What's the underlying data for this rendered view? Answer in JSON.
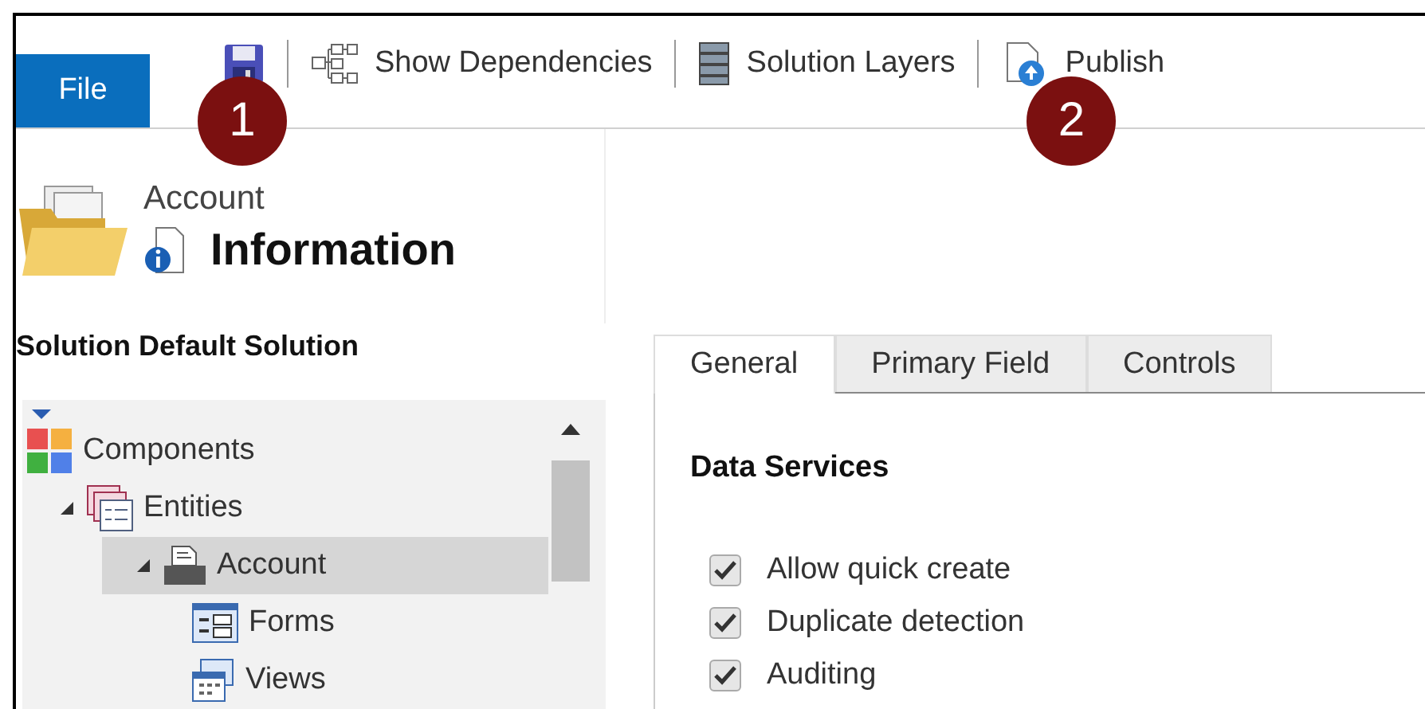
{
  "toolbar": {
    "file_button": "File",
    "items": [
      {
        "kind": "save",
        "callout": "1"
      },
      {
        "kind": "dependencies",
        "label": "Show Dependencies"
      },
      {
        "kind": "layers",
        "label": "Solution Layers"
      },
      {
        "kind": "publish",
        "label": "Publish",
        "callout": "2"
      }
    ]
  },
  "header": {
    "entity": "Account",
    "title": "Information"
  },
  "solution": "Solution Default Solution",
  "tree": [
    {
      "kind": "components",
      "label": "Components",
      "selected": false,
      "children": [
        {
          "kind": "entities",
          "label": "Entities",
          "expanded": true,
          "selected": false,
          "children": [
            {
              "kind": "entity",
              "label": "Account",
              "expanded": true,
              "selected": true,
              "children": [
                {
                  "kind": "forms",
                  "label": "Forms",
                  "selected": false
                },
                {
                  "kind": "views",
                  "label": "Views",
                  "selected": false
                }
              ]
            }
          ]
        }
      ]
    }
  ],
  "tabs": [
    {
      "label": "General",
      "selected": true
    },
    {
      "label": "Primary Field",
      "selected": false
    },
    {
      "label": "Controls",
      "selected": false
    }
  ],
  "section": {
    "title": "Data Services",
    "options": [
      {
        "label": "Allow quick create",
        "checked": true
      },
      {
        "label": "Duplicate detection",
        "checked": true
      },
      {
        "label": "Auditing",
        "checked": true
      }
    ]
  }
}
